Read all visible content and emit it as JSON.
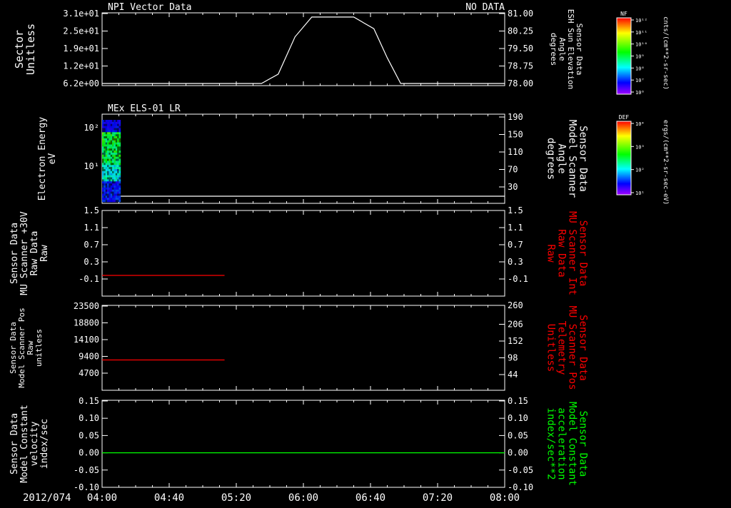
{
  "colors": {
    "bg": "#000000",
    "fg": "#ffffff",
    "red": "#ff0000",
    "green": "#00ff00"
  },
  "time_axis": {
    "date_label": "2012/074",
    "ticks": [
      "04:00",
      "04:40",
      "05:20",
      "06:00",
      "06:40",
      "07:20",
      "08:00"
    ]
  },
  "colorbars": [
    {
      "title": "NF",
      "unit": "cnts/(cm**2-sr-sec)",
      "ticks": [
        "10¹²",
        "10¹¹",
        "10¹⁰",
        "10⁹",
        "10⁸",
        "10⁷",
        "10⁶"
      ]
    },
    {
      "title": "DEF",
      "unit": "ergs/(cm**2-sr-sec-eV)",
      "ticks": [
        "10⁴",
        "10³",
        "10²",
        "10¹"
      ]
    }
  ],
  "chart_data": [
    {
      "type": "line",
      "title": "NPI Vector Data",
      "status": "NO DATA",
      "ylabel_left": [
        "Sector",
        "Unitless"
      ],
      "yticks_left": [
        "3.1e+01",
        "2.5e+01",
        "1.9e+01",
        "1.2e+01",
        "6.2e+00"
      ],
      "ylabel_right": [
        "Sensor Data",
        "ESH Sun Elevation",
        "Angle",
        "degrees"
      ],
      "yticks_right": [
        "81.00",
        "80.25",
        "79.50",
        "78.75",
        "78.00"
      ],
      "ylim_right": [
        77.9,
        81.1
      ],
      "series": [
        {
          "color": "#ffffff",
          "x": [
            "04:00",
            "05:35",
            "05:45",
            "05:55",
            "06:05",
            "06:30",
            "06:42",
            "06:50",
            "06:58",
            "08:00"
          ],
          "y": [
            78.0,
            78.0,
            78.4,
            80.0,
            80.85,
            80.85,
            80.35,
            79.1,
            78.0,
            78.0
          ]
        }
      ]
    },
    {
      "type": "heatmap",
      "title": "MEx ELS-01 LR",
      "ylabel_left": [
        "Electron Energy",
        "eV"
      ],
      "yticks_left": [
        "10²",
        "10¹"
      ],
      "ylabel_right": [
        "Sensor Data",
        "Model Scanner",
        "Angle",
        "degrees"
      ],
      "yticks_right": [
        "190",
        "150",
        "110",
        "70",
        "30"
      ],
      "ylim_right": [
        10,
        190
      ],
      "series": [
        {
          "color": "#ffffff",
          "x": [
            "04:00",
            "08:00"
          ],
          "y": [
            11,
            11
          ]
        }
      ],
      "spectrogram_x": [
        "04:00",
        "04:11"
      ]
    },
    {
      "type": "line",
      "ylabel_left": [
        "Sensor Data",
        "MU Scanner +30V",
        "Raw Data",
        "Raw"
      ],
      "yticks_left": [
        "1.5",
        "1.1",
        "0.7",
        "0.3",
        "-0.1"
      ],
      "ylim_left": [
        -0.3,
        1.5
      ],
      "ylabel_right": [
        "Sensor Data",
        "MU Scanner Int",
        "Raw Data",
        "Raw"
      ],
      "yticks_right": [
        "1.5",
        "1.1",
        "0.7",
        "0.3",
        "-0.1"
      ],
      "series": [
        {
          "color": "#ff0000",
          "x": [
            "04:00",
            "05:13"
          ],
          "y": [
            -0.1,
            -0.1
          ]
        }
      ]
    },
    {
      "type": "line",
      "ylabel_left": [
        "Sensor Data",
        "Model Scanner Pos",
        "Raw",
        "unitless"
      ],
      "yticks_left": [
        "23500",
        "18800",
        "14100",
        "9400",
        "4700"
      ],
      "ylim_left": [
        0,
        23500
      ],
      "ylabel_right": [
        "Sensor Data",
        "MU Scanner Pos",
        "Telemetry",
        "Unitless"
      ],
      "yticks_right": [
        "260",
        "206",
        "152",
        "98",
        "44"
      ],
      "series": [
        {
          "color": "#ff0000",
          "x": [
            "04:00",
            "05:13"
          ],
          "y": [
            8400,
            8400
          ]
        }
      ]
    },
    {
      "type": "line",
      "ylabel_left": [
        "Sensor Data",
        "Model Constant",
        "velocity",
        "index/sec"
      ],
      "yticks_left": [
        "0.15",
        "0.10",
        "0.05",
        "0.00",
        "-0.05",
        "-0.10"
      ],
      "ylim_left": [
        -0.1,
        0.15
      ],
      "ylabel_right": [
        "Sensor Data",
        "Model Constant",
        "acceleration",
        "index/sec**2"
      ],
      "yticks_right": [
        "0.15",
        "0.10",
        "0.05",
        "0.00",
        "-0.05",
        "-0.10"
      ],
      "series": [
        {
          "color": "#00ff00",
          "x": [
            "04:00",
            "08:00"
          ],
          "y": [
            0,
            0
          ]
        }
      ]
    }
  ]
}
